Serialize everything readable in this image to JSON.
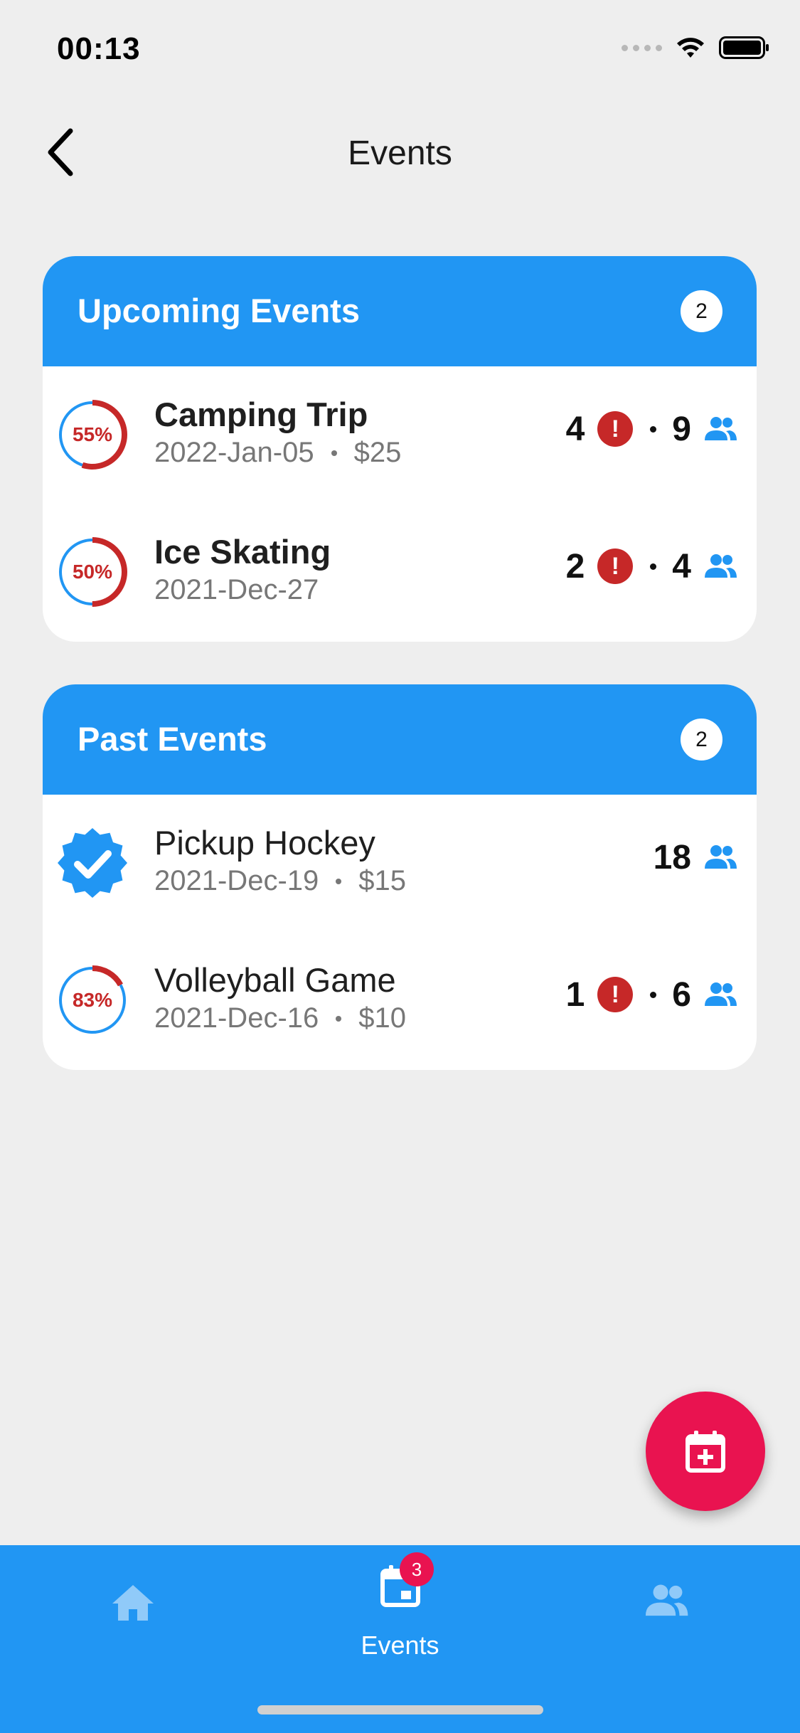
{
  "status_bar": {
    "time": "00:13"
  },
  "header": {
    "title": "Events"
  },
  "upcoming": {
    "title": "Upcoming Events",
    "count": "2",
    "events": [
      {
        "name": "Camping Trip",
        "date": "2022-Jan-05",
        "price": "$25",
        "progress_label": "55%",
        "progress": 0.55,
        "alerts": "4",
        "attendees": "9"
      },
      {
        "name": "Ice Skating",
        "date": "2021-Dec-27",
        "progress_label": "50%",
        "progress": 0.5,
        "alerts": "2",
        "attendees": "4"
      }
    ]
  },
  "past": {
    "title": "Past Events",
    "count": "2",
    "events": [
      {
        "name": "Pickup Hockey",
        "date": "2021-Dec-19",
        "price": "$15",
        "status": "verified-icon",
        "attendees": "18"
      },
      {
        "name": "Volleyball Game",
        "date": "2021-Dec-16",
        "price": "$10",
        "progress_label": "83%",
        "progress": 0.17,
        "alerts": "1",
        "attendees": "6"
      }
    ]
  },
  "bottom_nav": {
    "tabs": [
      {
        "icon": "home-icon"
      },
      {
        "icon": "calendar-icon",
        "label": "Events",
        "badge": "3"
      },
      {
        "icon": "people-icon"
      }
    ]
  },
  "fab": {
    "icon": "calendar-plus-icon"
  },
  "colors": {
    "accent": "#2196f3",
    "alert": "#c62828",
    "fab": "#e91350"
  }
}
